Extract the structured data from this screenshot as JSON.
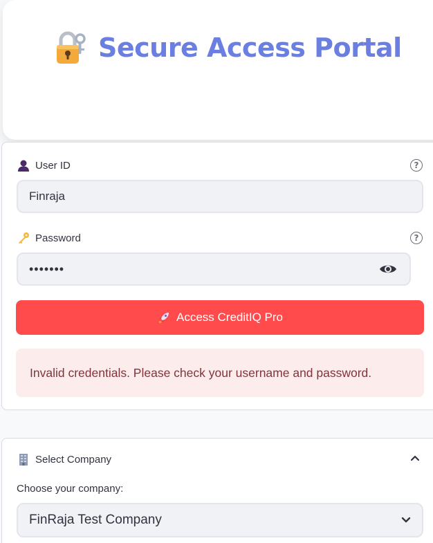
{
  "hero": {
    "title": "Secure Access Portal",
    "icon": "lock-with-key-icon"
  },
  "login": {
    "user_id": {
      "label": "User ID",
      "value": "Finraja",
      "icon": "user-silhouette-icon",
      "help_icon": "question-circle-icon"
    },
    "password": {
      "label": "Password",
      "value": "•••••••",
      "icon": "key-icon",
      "help_icon": "question-circle-icon",
      "toggle_icon": "eye-icon"
    },
    "submit": {
      "label": "Access CreditIQ Pro",
      "icon": "rocket-icon",
      "color": "#ff4b4b"
    },
    "error": {
      "message": "Invalid credentials. Please check your username and password.",
      "color": "#fdecec"
    }
  },
  "company": {
    "header": "Select Company",
    "header_icon": "office-building-icon",
    "expanded": true,
    "select_label": "Choose your company:",
    "selected": "FinRaja Test Company"
  },
  "colors": {
    "accent": "#6b7fe0",
    "primary": "#ff4b4b"
  }
}
